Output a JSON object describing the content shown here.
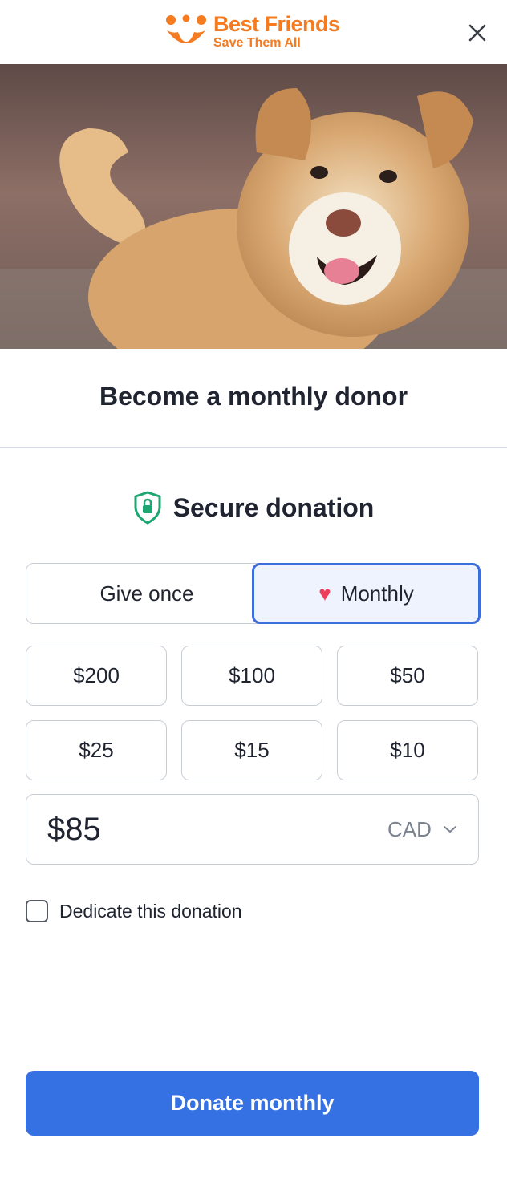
{
  "header": {
    "logo_title": "Best Friends",
    "logo_tagline": "Save Them All",
    "close_icon": "close-icon"
  },
  "hero": {
    "image": "dog-photo"
  },
  "title": "Become a monthly donor",
  "secure": {
    "icon": "shield-lock-icon",
    "label": "Secure donation"
  },
  "frequency": {
    "give_once": "Give once",
    "monthly": "Monthly",
    "selected": "Monthly"
  },
  "amounts": [
    "$200",
    "$100",
    "$50",
    "$25",
    "$15",
    "$10"
  ],
  "custom_amount": {
    "value": "$85",
    "currency": "CAD"
  },
  "dedicate": {
    "label": "Dedicate this donation",
    "checked": false
  },
  "cta": {
    "label": "Donate monthly"
  },
  "colors": {
    "brand_orange": "#f47b20",
    "accent_blue": "#3571e3",
    "selected_border": "#3b6fdb",
    "heart": "#ef3e5c",
    "shield_green": "#1ea672"
  }
}
